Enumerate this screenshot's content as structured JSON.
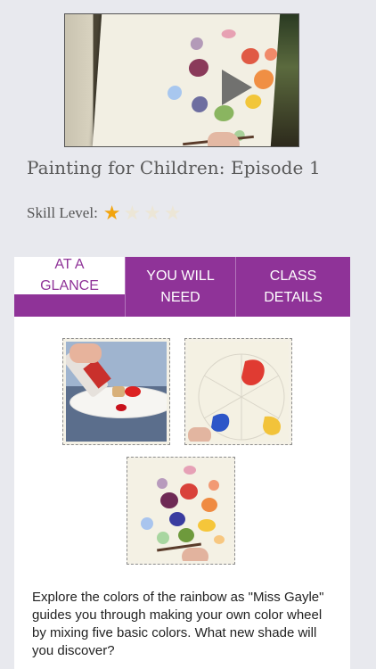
{
  "video": {
    "play_icon": "play-icon"
  },
  "episode_title": "Painting for Children: Episode 1",
  "skill": {
    "label": "Skill Level:",
    "rating": 1,
    "max": 5,
    "colors": {
      "on": "#f2a40d",
      "off": "#ece6d6"
    }
  },
  "tabs": [
    {
      "label": "AT A GLANCE",
      "active": true
    },
    {
      "label": "YOU WILL NEED",
      "active": false
    },
    {
      "label": "CLASS DETAILS",
      "active": false
    }
  ],
  "accent_color": "#8f3398",
  "gallery": [
    "thumb-paint-bottle",
    "thumb-color-wheel-sketch",
    "thumb-finished-color-wheel"
  ],
  "description": "Explore the colors of the rainbow as \"Miss Gayle\" guides you through making your own color wheel by mixing five basic colors. What new shade will you discover?"
}
